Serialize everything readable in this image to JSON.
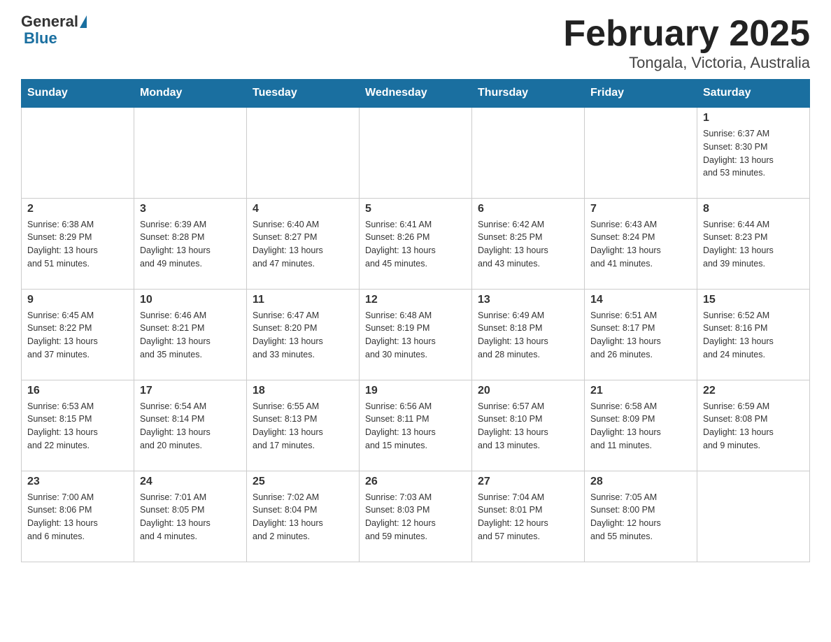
{
  "logo": {
    "general": "General",
    "blue": "Blue"
  },
  "title": "February 2025",
  "subtitle": "Tongala, Victoria, Australia",
  "days_of_week": [
    "Sunday",
    "Monday",
    "Tuesday",
    "Wednesday",
    "Thursday",
    "Friday",
    "Saturday"
  ],
  "weeks": [
    [
      {
        "day": "",
        "info": ""
      },
      {
        "day": "",
        "info": ""
      },
      {
        "day": "",
        "info": ""
      },
      {
        "day": "",
        "info": ""
      },
      {
        "day": "",
        "info": ""
      },
      {
        "day": "",
        "info": ""
      },
      {
        "day": "1",
        "info": "Sunrise: 6:37 AM\nSunset: 8:30 PM\nDaylight: 13 hours\nand 53 minutes."
      }
    ],
    [
      {
        "day": "2",
        "info": "Sunrise: 6:38 AM\nSunset: 8:29 PM\nDaylight: 13 hours\nand 51 minutes."
      },
      {
        "day": "3",
        "info": "Sunrise: 6:39 AM\nSunset: 8:28 PM\nDaylight: 13 hours\nand 49 minutes."
      },
      {
        "day": "4",
        "info": "Sunrise: 6:40 AM\nSunset: 8:27 PM\nDaylight: 13 hours\nand 47 minutes."
      },
      {
        "day": "5",
        "info": "Sunrise: 6:41 AM\nSunset: 8:26 PM\nDaylight: 13 hours\nand 45 minutes."
      },
      {
        "day": "6",
        "info": "Sunrise: 6:42 AM\nSunset: 8:25 PM\nDaylight: 13 hours\nand 43 minutes."
      },
      {
        "day": "7",
        "info": "Sunrise: 6:43 AM\nSunset: 8:24 PM\nDaylight: 13 hours\nand 41 minutes."
      },
      {
        "day": "8",
        "info": "Sunrise: 6:44 AM\nSunset: 8:23 PM\nDaylight: 13 hours\nand 39 minutes."
      }
    ],
    [
      {
        "day": "9",
        "info": "Sunrise: 6:45 AM\nSunset: 8:22 PM\nDaylight: 13 hours\nand 37 minutes."
      },
      {
        "day": "10",
        "info": "Sunrise: 6:46 AM\nSunset: 8:21 PM\nDaylight: 13 hours\nand 35 minutes."
      },
      {
        "day": "11",
        "info": "Sunrise: 6:47 AM\nSunset: 8:20 PM\nDaylight: 13 hours\nand 33 minutes."
      },
      {
        "day": "12",
        "info": "Sunrise: 6:48 AM\nSunset: 8:19 PM\nDaylight: 13 hours\nand 30 minutes."
      },
      {
        "day": "13",
        "info": "Sunrise: 6:49 AM\nSunset: 8:18 PM\nDaylight: 13 hours\nand 28 minutes."
      },
      {
        "day": "14",
        "info": "Sunrise: 6:51 AM\nSunset: 8:17 PM\nDaylight: 13 hours\nand 26 minutes."
      },
      {
        "day": "15",
        "info": "Sunrise: 6:52 AM\nSunset: 8:16 PM\nDaylight: 13 hours\nand 24 minutes."
      }
    ],
    [
      {
        "day": "16",
        "info": "Sunrise: 6:53 AM\nSunset: 8:15 PM\nDaylight: 13 hours\nand 22 minutes."
      },
      {
        "day": "17",
        "info": "Sunrise: 6:54 AM\nSunset: 8:14 PM\nDaylight: 13 hours\nand 20 minutes."
      },
      {
        "day": "18",
        "info": "Sunrise: 6:55 AM\nSunset: 8:13 PM\nDaylight: 13 hours\nand 17 minutes."
      },
      {
        "day": "19",
        "info": "Sunrise: 6:56 AM\nSunset: 8:11 PM\nDaylight: 13 hours\nand 15 minutes."
      },
      {
        "day": "20",
        "info": "Sunrise: 6:57 AM\nSunset: 8:10 PM\nDaylight: 13 hours\nand 13 minutes."
      },
      {
        "day": "21",
        "info": "Sunrise: 6:58 AM\nSunset: 8:09 PM\nDaylight: 13 hours\nand 11 minutes."
      },
      {
        "day": "22",
        "info": "Sunrise: 6:59 AM\nSunset: 8:08 PM\nDaylight: 13 hours\nand 9 minutes."
      }
    ],
    [
      {
        "day": "23",
        "info": "Sunrise: 7:00 AM\nSunset: 8:06 PM\nDaylight: 13 hours\nand 6 minutes."
      },
      {
        "day": "24",
        "info": "Sunrise: 7:01 AM\nSunset: 8:05 PM\nDaylight: 13 hours\nand 4 minutes."
      },
      {
        "day": "25",
        "info": "Sunrise: 7:02 AM\nSunset: 8:04 PM\nDaylight: 13 hours\nand 2 minutes."
      },
      {
        "day": "26",
        "info": "Sunrise: 7:03 AM\nSunset: 8:03 PM\nDaylight: 12 hours\nand 59 minutes."
      },
      {
        "day": "27",
        "info": "Sunrise: 7:04 AM\nSunset: 8:01 PM\nDaylight: 12 hours\nand 57 minutes."
      },
      {
        "day": "28",
        "info": "Sunrise: 7:05 AM\nSunset: 8:00 PM\nDaylight: 12 hours\nand 55 minutes."
      },
      {
        "day": "",
        "info": ""
      }
    ]
  ]
}
